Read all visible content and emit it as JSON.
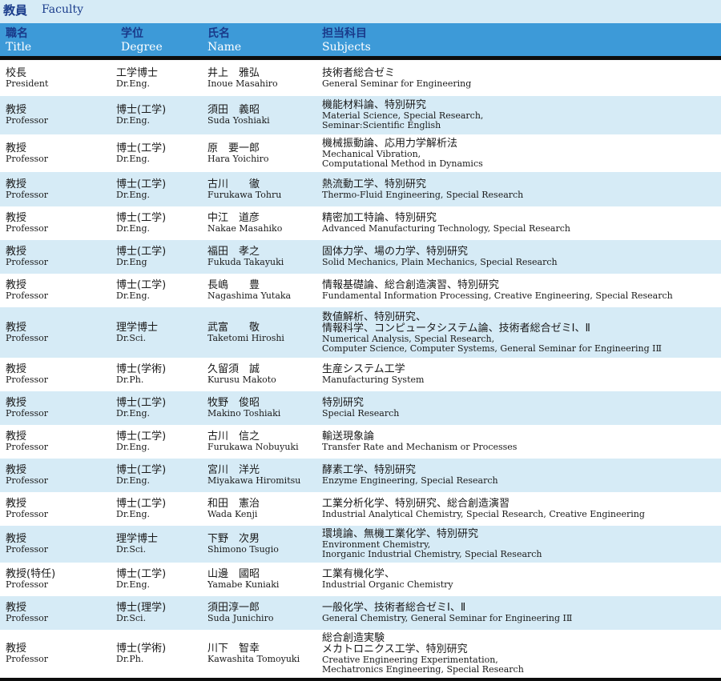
{
  "page": {
    "title_jp": "教員",
    "title_en": "Faculty"
  },
  "header": {
    "title_jp": "職名",
    "title_en": "Title",
    "degree_jp": "学位",
    "degree_en": "Degree",
    "name_jp": "氏名",
    "name_en": "Name",
    "subjects_jp": "担当科目",
    "subjects_en": "Subjects"
  },
  "rows": [
    {
      "title_jp": "校長",
      "title_en": "President",
      "degree_jp": "工学博士",
      "degree_en": "Dr.Eng.",
      "name_jp": "井上　雅弘",
      "name_en": "Inoue Masahiro",
      "subjects": [
        "技術者総合ゼミ",
        "General Seminar for Engineering"
      ]
    },
    {
      "title_jp": "教授",
      "title_en": "Professor",
      "degree_jp": "博士(工学)",
      "degree_en": "Dr.Eng.",
      "name_jp": "須田　義昭",
      "name_en": "Suda Yoshiaki",
      "subjects": [
        "機能材料論、特別研究",
        "Material Science, Special Research,",
        "Seminar:Scientific English"
      ]
    },
    {
      "title_jp": "教授",
      "title_en": "Professor",
      "degree_jp": "博士(工学)",
      "degree_en": "Dr.Eng.",
      "name_jp": "原　要一郎",
      "name_en": "Hara Yoichiro",
      "subjects": [
        "機械振動論、応用力学解析法",
        "Mechanical Vibration,",
        "Computational Method in Dynamics"
      ]
    },
    {
      "title_jp": "教授",
      "title_en": "Professor",
      "degree_jp": "博士(工学)",
      "degree_en": "Dr.Eng.",
      "name_jp": "古川　　徹",
      "name_en": "Furukawa Tohru",
      "subjects": [
        "熱流動工学、特別研究",
        "Thermo-Fluid Engineering, Special Research"
      ]
    },
    {
      "title_jp": "教授",
      "title_en": "Professor",
      "degree_jp": "博士(工学)",
      "degree_en": "Dr.Eng.",
      "name_jp": "中江　道彦",
      "name_en": "Nakae Masahiko",
      "subjects": [
        "精密加工特論、特別研究",
        "Advanced Manufacturing Technology, Special Research"
      ]
    },
    {
      "title_jp": "教授",
      "title_en": "Professor",
      "degree_jp": "博士(工学)",
      "degree_en": "Dr.Eng",
      "name_jp": "福田　孝之",
      "name_en": "Fukuda Takayuki",
      "subjects": [
        "固体力学、場の力学、特別研究",
        "Solid Mechanics, Plain Mechanics, Special Research"
      ]
    },
    {
      "title_jp": "教授",
      "title_en": "Professor",
      "degree_jp": "博士(工学)",
      "degree_en": "Dr.Eng.",
      "name_jp": "長嶋　　豊",
      "name_en": "Nagashima Yutaka",
      "subjects": [
        "情報基礎論、総合創造演習、特別研究",
        "Fundamental Information Processing, Creative Engineering, Special Research"
      ]
    },
    {
      "title_jp": "教授",
      "title_en": "Professor",
      "degree_jp": "理学博士",
      "degree_en": "Dr.Sci.",
      "name_jp": "武富　　敬",
      "name_en": "Taketomi Hiroshi",
      "subjects": [
        "数値解析、特別研究、",
        "情報科学、コンピュータシステム論、技術者総合ゼミⅠ、Ⅱ",
        "Numerical Analysis, Special Research,",
        "Computer Science, Computer Systems,  General Seminar for Engineering ⅠⅡ"
      ]
    },
    {
      "title_jp": "教授",
      "title_en": "Professor",
      "degree_jp": "博士(学術)",
      "degree_en": "Dr.Ph.",
      "name_jp": "久留須　誠",
      "name_en": "Kurusu Makoto",
      "subjects": [
        "生産システム工学",
        "Manufacturing System"
      ]
    },
    {
      "title_jp": "教授",
      "title_en": "Professor",
      "degree_jp": "博士(工学)",
      "degree_en": "Dr.Eng.",
      "name_jp": "牧野　俊昭",
      "name_en": "Makino Toshiaki",
      "subjects": [
        "特別研究",
        "Special Research"
      ]
    },
    {
      "title_jp": "教授",
      "title_en": "Professor",
      "degree_jp": "博士(工学)",
      "degree_en": "Dr.Eng.",
      "name_jp": "古川　信之",
      "name_en": "Furukawa Nobuyuki",
      "subjects": [
        "輸送現象論",
        "Transfer Rate and Mechanism or Processes"
      ]
    },
    {
      "title_jp": "教授",
      "title_en": "Professor",
      "degree_jp": "博士(工学)",
      "degree_en": "Dr.Eng.",
      "name_jp": "宮川　洋光",
      "name_en": "Miyakawa Hiromitsu",
      "subjects": [
        "酵素工学、特別研究",
        "Enzyme Engineering,  Special Research"
      ]
    },
    {
      "title_jp": "教授",
      "title_en": "Professor",
      "degree_jp": "博士(工学)",
      "degree_en": "Dr.Eng.",
      "name_jp": "和田　憲治",
      "name_en": "Wada Kenji",
      "subjects": [
        "工業分析化学、特別研究、総合創造演習",
        "Industrial Analytical Chemistry, Special Research, Creative Engineering"
      ]
    },
    {
      "title_jp": "教授",
      "title_en": "Professor",
      "degree_jp": "理学博士",
      "degree_en": "Dr.Sci.",
      "name_jp": "下野　次男",
      "name_en": "Shimono Tsugio",
      "subjects": [
        "環境論、無機工業化学、特別研究",
        "Environment Chemistry,",
        "Inorganic Industrial Chemistry, Special Research"
      ]
    },
    {
      "title_jp": "教授(特任)",
      "title_en": "Professor",
      "degree_jp": "博士(工学)",
      "degree_en": "Dr.Eng.",
      "name_jp": "山邊　國昭",
      "name_en": "Yamabe Kuniaki",
      "subjects": [
        "工業有機化学、",
        "Industrial Organic Chemistry"
      ]
    },
    {
      "title_jp": "教授",
      "title_en": "Professor",
      "degree_jp": "博士(理学)",
      "degree_en": "Dr.Sci.",
      "name_jp": "須田淳一郎",
      "name_en": "Suda Junichiro",
      "subjects": [
        "一般化学、技術者総合ゼミⅠ、Ⅱ",
        "General Chemistry,  General Seminar for Engineering ⅠⅡ"
      ]
    },
    {
      "title_jp": "教授",
      "title_en": "Professor",
      "degree_jp": "博士(学術)",
      "degree_en": "Dr.Ph.",
      "name_jp": "川下　智幸",
      "name_en": "Kawashita Tomoyuki",
      "subjects": [
        "総合創造実験",
        "メカトロニクス工学、特別研究",
        "Creative Engineering Experimentation,",
        "Mechatronics Engineering, Special Research"
      ]
    }
  ]
}
